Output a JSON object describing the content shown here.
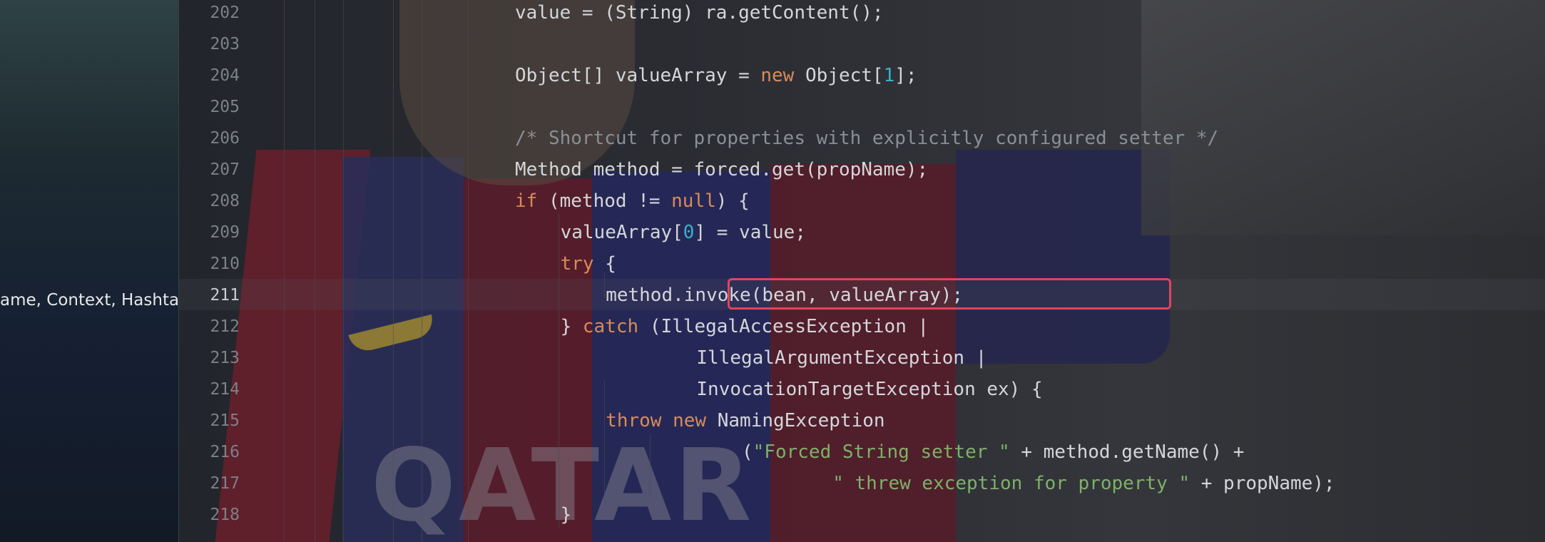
{
  "left_panel": {
    "text": "ame, Context, Hashtal"
  },
  "editor": {
    "lines": [
      {
        "n": "202",
        "code": [
          {
            "t": "value = (String) ra.getContent();"
          }
        ],
        "indent": 1
      },
      {
        "n": "203",
        "code": [],
        "indent": 1
      },
      {
        "n": "204",
        "code": [
          {
            "t": "Object[] valueArray = "
          },
          {
            "t": "new",
            "c": "kw"
          },
          {
            "t": " Object["
          },
          {
            "t": "1",
            "c": "num"
          },
          {
            "t": "];"
          }
        ],
        "indent": 1
      },
      {
        "n": "205",
        "code": [],
        "indent": 1
      },
      {
        "n": "206",
        "code": [
          {
            "t": "/* Shortcut for properties with explicitly configured setter */",
            "c": "cm"
          }
        ],
        "indent": 1
      },
      {
        "n": "207",
        "code": [
          {
            "t": "Method method = forced.get(propName);"
          }
        ],
        "indent": 1
      },
      {
        "n": "208",
        "code": [
          {
            "t": "if",
            "c": "kw"
          },
          {
            "t": " (method != "
          },
          {
            "t": "null",
            "c": "kw"
          },
          {
            "t": ") {"
          }
        ],
        "indent": 1
      },
      {
        "n": "209",
        "code": [
          {
            "t": "valueArray["
          },
          {
            "t": "0",
            "c": "num"
          },
          {
            "t": "] = value;"
          }
        ],
        "indent": 2
      },
      {
        "n": "210",
        "code": [
          {
            "t": "try",
            "c": "kw"
          },
          {
            "t": " {"
          }
        ],
        "indent": 2
      },
      {
        "n": "211",
        "code": [
          {
            "t": "method.invoke(bean, valueArray);"
          }
        ],
        "indent": 3,
        "current": true
      },
      {
        "n": "212",
        "code": [
          {
            "t": "} "
          },
          {
            "t": "catch",
            "c": "kw"
          },
          {
            "t": " (IllegalAccessException |"
          }
        ],
        "indent": 2
      },
      {
        "n": "213",
        "code": [
          {
            "t": "IllegalArgumentException |"
          }
        ],
        "indent": 5
      },
      {
        "n": "214",
        "code": [
          {
            "t": "InvocationTargetException ex) {"
          }
        ],
        "indent": 5
      },
      {
        "n": "215",
        "code": [
          {
            "t": "throw",
            "c": "kw"
          },
          {
            "t": " "
          },
          {
            "t": "new",
            "c": "kw"
          },
          {
            "t": " NamingException"
          }
        ],
        "indent": 3
      },
      {
        "n": "216",
        "code": [
          {
            "t": "("
          },
          {
            "t": "\"Forced String setter \"",
            "c": "str"
          },
          {
            "t": " + method.getName() +"
          }
        ],
        "indent": 6
      },
      {
        "n": "217",
        "code": [
          {
            "t": "\" threw exception for property \"",
            "c": "str"
          },
          {
            "t": " + propName);"
          }
        ],
        "indent": 8
      },
      {
        "n": "218",
        "code": [
          {
            "t": "}"
          }
        ],
        "indent": 2
      }
    ]
  },
  "colors": {
    "keyword": "#d88b5a",
    "number": "#3bb0c9",
    "comment": "#8a8f96",
    "string": "#7fb069",
    "highlight_border": "#e2445a"
  }
}
